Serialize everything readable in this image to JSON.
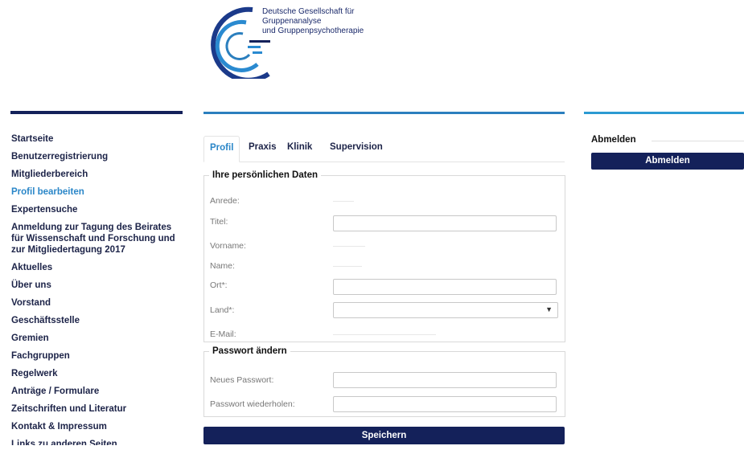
{
  "header": {
    "org_line1": "Deutsche Gesellschaft für",
    "org_line2": "Gruppenanalyse",
    "org_line3": "und Gruppenpsychotherapie",
    "logo_icon": "dgg-logo-arcs",
    "brand_dark": "#14215a",
    "brand_light": "#2b7fbe"
  },
  "sidebar": {
    "items": [
      {
        "label": "Startseite"
      },
      {
        "label": "Benutzerregistrierung"
      },
      {
        "label": "Mitgliederbereich"
      },
      {
        "label": "Profil bearbeiten"
      },
      {
        "label": "Expertensuche"
      },
      {
        "label": "Anmeldung zur Tagung des Beirates für Wissenschaft und Forschung und zur Mitgliedertagung 2017"
      },
      {
        "label": "Aktuelles"
      },
      {
        "label": "Über uns"
      },
      {
        "label": "Vorstand"
      },
      {
        "label": "Geschäftsstelle"
      },
      {
        "label": "Gremien"
      },
      {
        "label": "Fachgruppen"
      },
      {
        "label": "Regelwerk"
      },
      {
        "label": "Anträge / Formulare"
      },
      {
        "label": "Zeitschriften und Literatur"
      },
      {
        "label": "Kontakt & Impressum"
      },
      {
        "label": "Links zu anderen Seiten"
      }
    ],
    "active_index": 3
  },
  "tabs": [
    {
      "label": "Profil"
    },
    {
      "label": "Praxis"
    },
    {
      "label": "Klinik"
    },
    {
      "label": "Supervision"
    }
  ],
  "personal": {
    "legend": "Ihre persönlichen Daten",
    "anrede_label": "Anrede:",
    "titel_label": "Titel:",
    "vorname_label": "Vorname:",
    "name_label": "Name:",
    "ort_label": "Ort*:",
    "land_label": "Land*:",
    "email_label": "E-Mail:",
    "select_arrow": "▼"
  },
  "password": {
    "legend": "Passwort ändern",
    "new_label": "Neues Passwort:",
    "repeat_label": "Passwort wiederholen:"
  },
  "save_label": "Speichern",
  "logout": {
    "title": "Abmelden",
    "button": "Abmelden"
  }
}
